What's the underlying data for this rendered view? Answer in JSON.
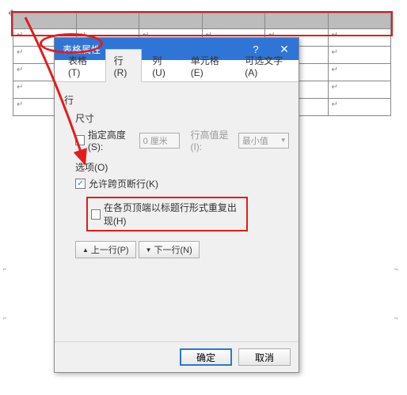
{
  "table": {
    "cell_marker": "↵"
  },
  "dialog": {
    "title": "表格属性",
    "help": "?",
    "close": "✕",
    "tabs": [
      {
        "label": "表格(T)"
      },
      {
        "label": "行(R)"
      },
      {
        "label": "列(U)"
      },
      {
        "label": "单元格(E)"
      },
      {
        "label": "可选文字(A)"
      }
    ],
    "row_section": "行",
    "size_label": "尺寸",
    "specify_height": "指定高度(S):",
    "height_value": "0 厘米",
    "row_height_is": "行高值是(I):",
    "row_height_mode": "最小值",
    "options_label": "选项(O)",
    "allow_break": "允许跨页断行(K)",
    "repeat_header": "在各页顶端以标题行形式重复出现(H)",
    "prev_row": "上一行(P)",
    "next_row": "下一行(N)",
    "ok": "确定",
    "cancel": "取消"
  },
  "annotation_colors": {
    "highlight": "#e31c1c"
  }
}
